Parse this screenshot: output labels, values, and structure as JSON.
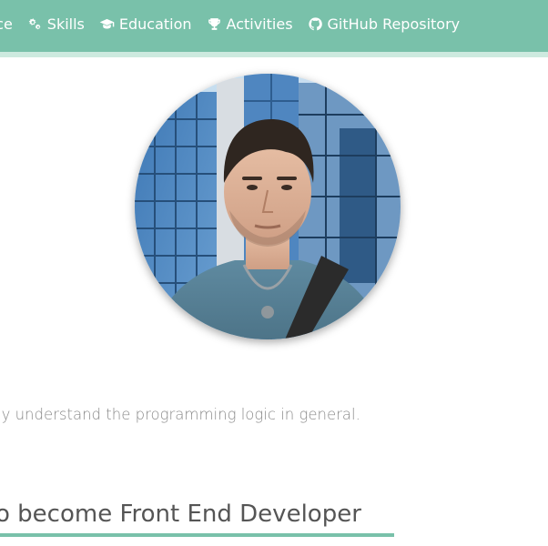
{
  "nav": {
    "items": [
      {
        "label": "nce",
        "icon": "none"
      },
      {
        "label": "Skills",
        "icon": "gears-icon"
      },
      {
        "label": "Education",
        "icon": "graduation-cap-icon"
      },
      {
        "label": "Activities",
        "icon": "trophy-icon"
      },
      {
        "label": "GitHub Repository",
        "icon": "github-icon"
      }
    ]
  },
  "profile": {
    "avatar_alt": "profile photo"
  },
  "about": {
    "text": "ly understand the programming logic in general."
  },
  "goal": {
    "heading": "o become Front End Developer"
  },
  "colors": {
    "accent": "#79c1aa",
    "accent_light": "#cdeadf",
    "text_muted": "#8a8a8a",
    "heading": "#555555"
  }
}
